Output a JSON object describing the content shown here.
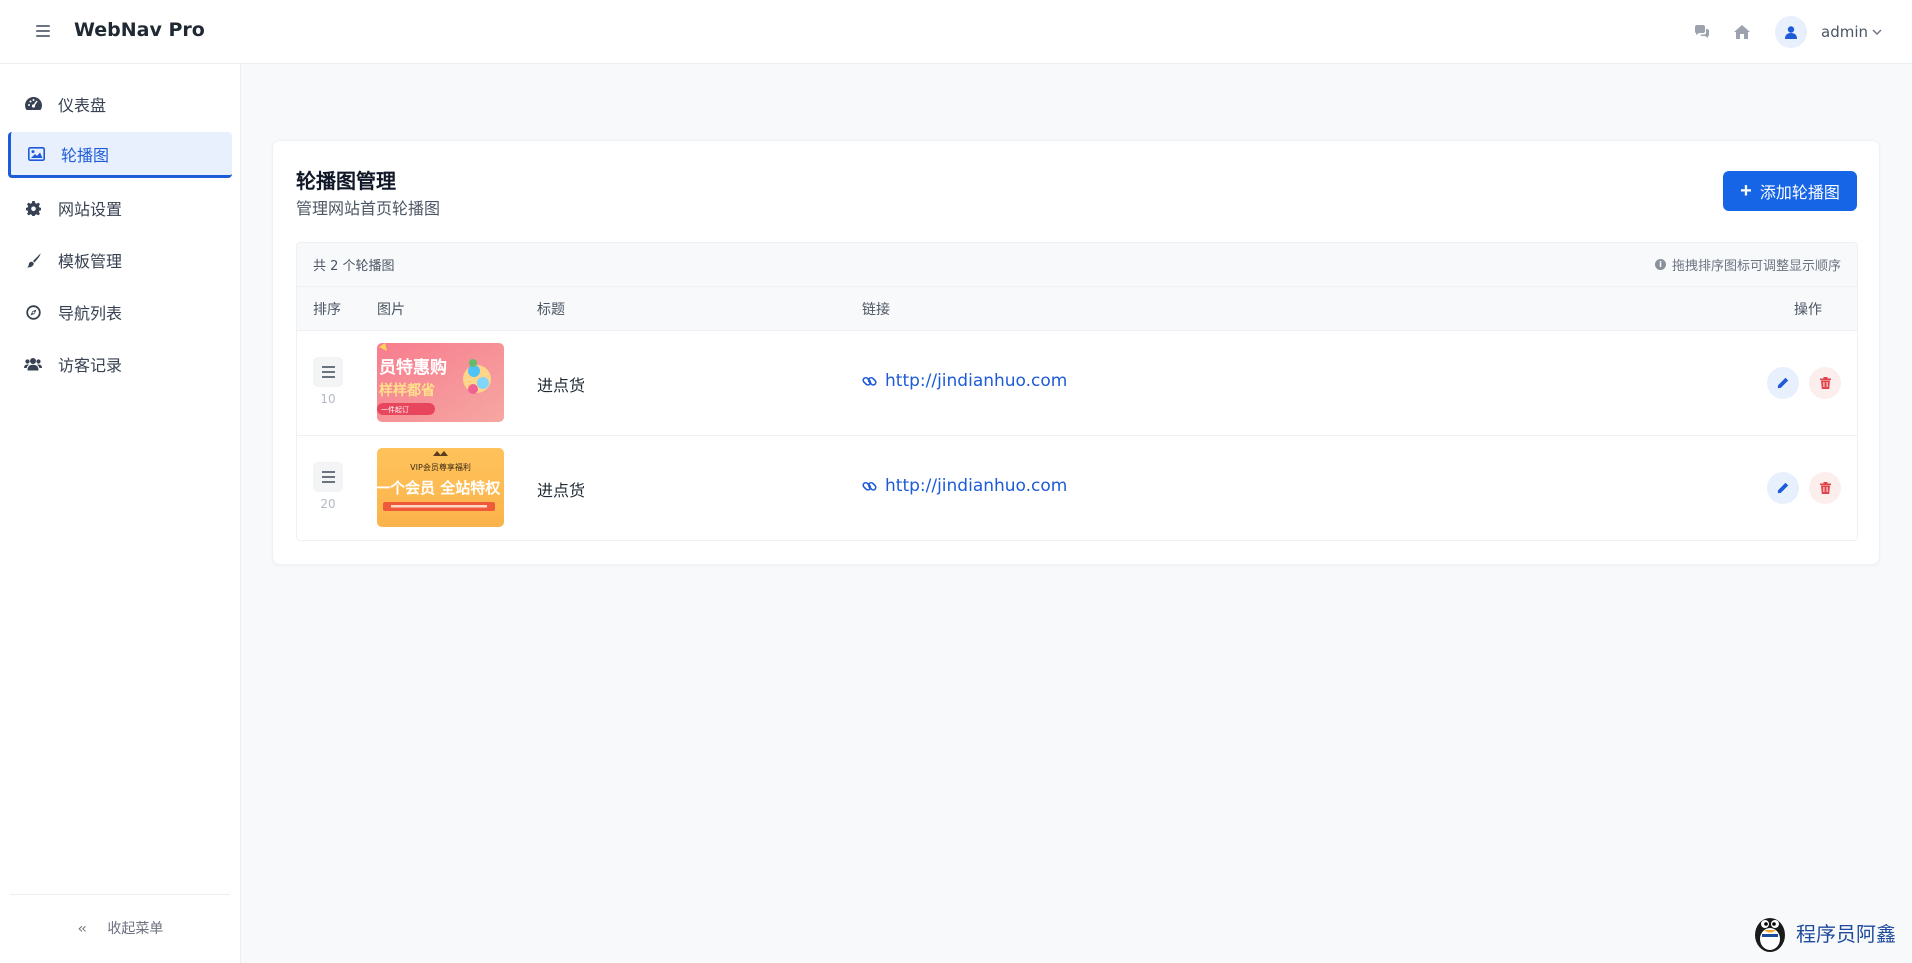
{
  "app": {
    "brand": "WebNav Pro",
    "user": "admin"
  },
  "sidebar": {
    "items": [
      {
        "label": "仪表盘",
        "icon": "dashboard-icon"
      },
      {
        "label": "轮播图",
        "icon": "image-icon",
        "active": true
      },
      {
        "label": "网站设置",
        "icon": "gear-icon"
      },
      {
        "label": "模板管理",
        "icon": "brush-icon"
      },
      {
        "label": "导航列表",
        "icon": "compass-icon"
      },
      {
        "label": "访客记录",
        "icon": "users-icon"
      }
    ],
    "collapse_label": "收起菜单"
  },
  "page": {
    "title": "轮播图管理",
    "subtitle": "管理网站首页轮播图",
    "add_button": "添加轮播图"
  },
  "table": {
    "summary": "共 2 个轮播图",
    "hint": "拖拽排序图标可调整显示顺序",
    "headers": {
      "sort": "排序",
      "image": "图片",
      "title": "标题",
      "link": "链接",
      "ops": "操作"
    },
    "rows": [
      {
        "sort": "10",
        "title": "进点货",
        "link": "http://jindianhuo.com",
        "image_text": [
          "员特惠购",
          "样样都省",
          "一件起订"
        ]
      },
      {
        "sort": "20",
        "title": "进点货",
        "link": "http://jindianhuo.com",
        "image_text": [
          "VIP会员尊享福利",
          "一个会员 全站特权"
        ]
      }
    ]
  },
  "watermark": "程序员阿鑫",
  "colors": {
    "accent": "#1565e6",
    "active_bg": "#e9f0fd",
    "link": "#1d5bd8",
    "danger": "#e0454b"
  }
}
